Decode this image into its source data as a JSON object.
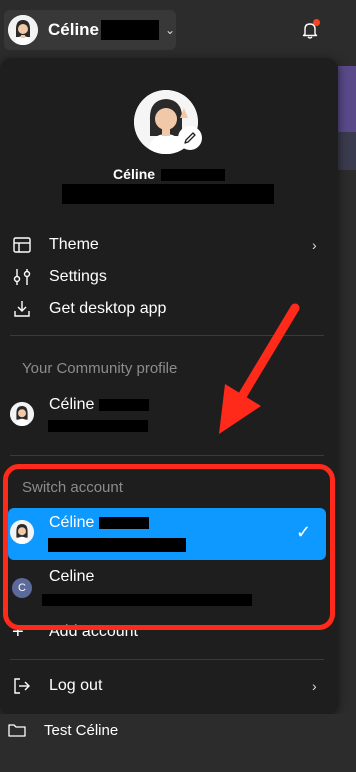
{
  "topbar": {
    "user_name": "Céline",
    "chevron": "chevron-down-icon",
    "notifications_icon": "bell-icon"
  },
  "profile": {
    "name": "Céline"
  },
  "menu": {
    "items": [
      {
        "label": "Theme",
        "icon": "layout-icon",
        "has_submenu": true
      },
      {
        "label": "Settings",
        "icon": "sliders-icon",
        "has_submenu": false
      },
      {
        "label": "Get desktop app",
        "icon": "download-icon",
        "has_submenu": false
      }
    ],
    "community": {
      "section_label": "Your Community profile",
      "name": "Céline"
    },
    "switch": {
      "section_label": "Switch account",
      "accounts": [
        {
          "name": "Céline",
          "selected": true
        },
        {
          "name": "Celine",
          "initial": "C",
          "selected": false
        }
      ],
      "add_label": "Add account"
    },
    "logout_label": "Log out"
  },
  "file_browser": {
    "folder_label": "Test Céline"
  },
  "colors": {
    "accent": "#0d99ff",
    "annotation": "#ff2a1a",
    "menu_bg": "#1e1e1e"
  }
}
